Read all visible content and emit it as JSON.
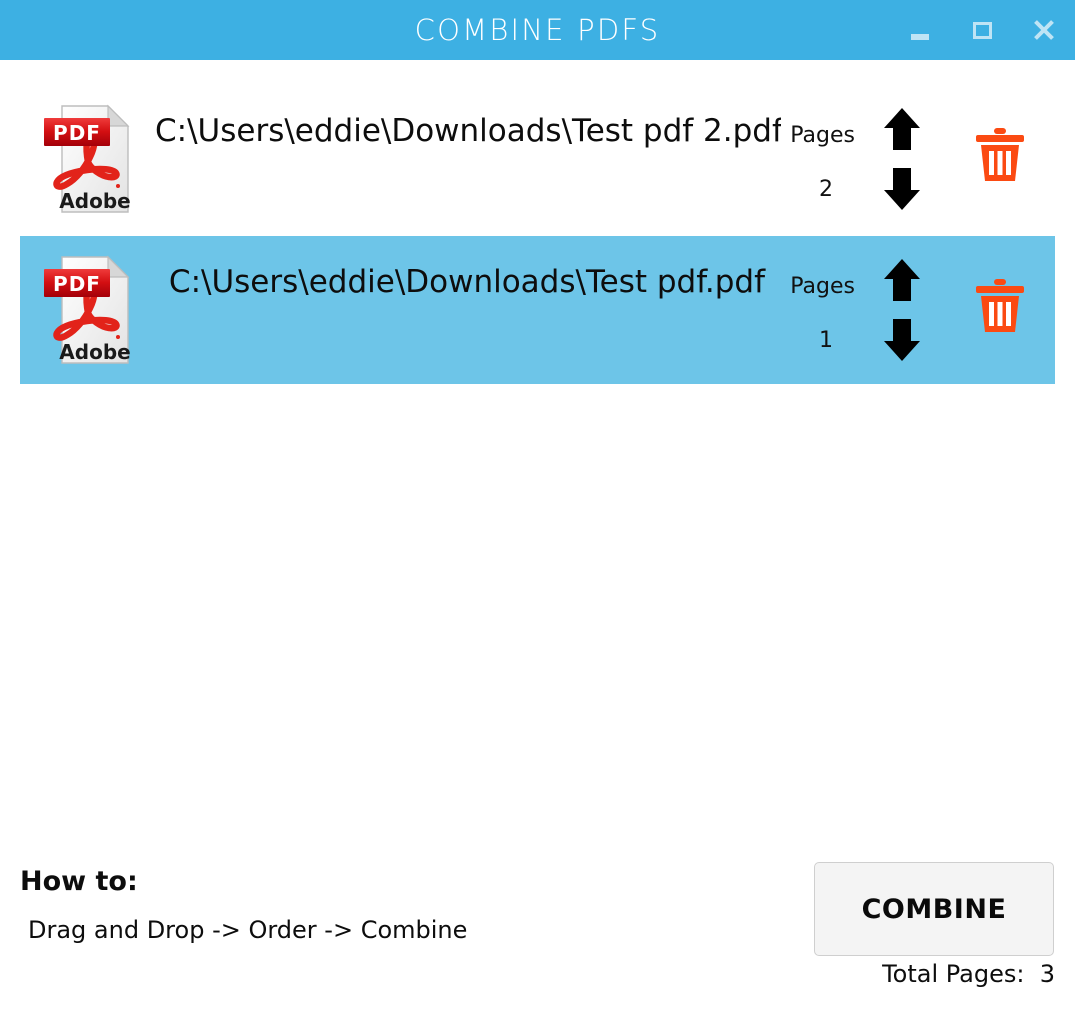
{
  "window": {
    "title": "COMBINE PDFS",
    "titlebar_color": "#3db0e3",
    "minimize_label": "Minimize",
    "maximize_label": "Maximize",
    "close_label": "Close"
  },
  "file_list": {
    "pages_label": "Pages",
    "selected_row_color": "#6dc5e8",
    "delete_icon_color": "#fb4a12",
    "files": [
      {
        "path": "C:\\Users\\eddie\\Downloads\\Test pdf 2.pdf",
        "pages": "2",
        "selected": false,
        "icon": "pdf-file-icon",
        "icon_badge": "PDF",
        "icon_brand": "Adobe"
      },
      {
        "path": "C:\\Users\\eddie\\Downloads\\Test pdf.pdf",
        "pages": "1",
        "selected": true,
        "icon": "pdf-file-icon",
        "icon_badge": "PDF",
        "icon_brand": "Adobe"
      }
    ]
  },
  "footer": {
    "howto_title": "How to:",
    "howto_steps": "Drag and Drop -> Order -> Combine",
    "combine_label": "COMBINE",
    "total_pages_label": "Total Pages:  3"
  }
}
